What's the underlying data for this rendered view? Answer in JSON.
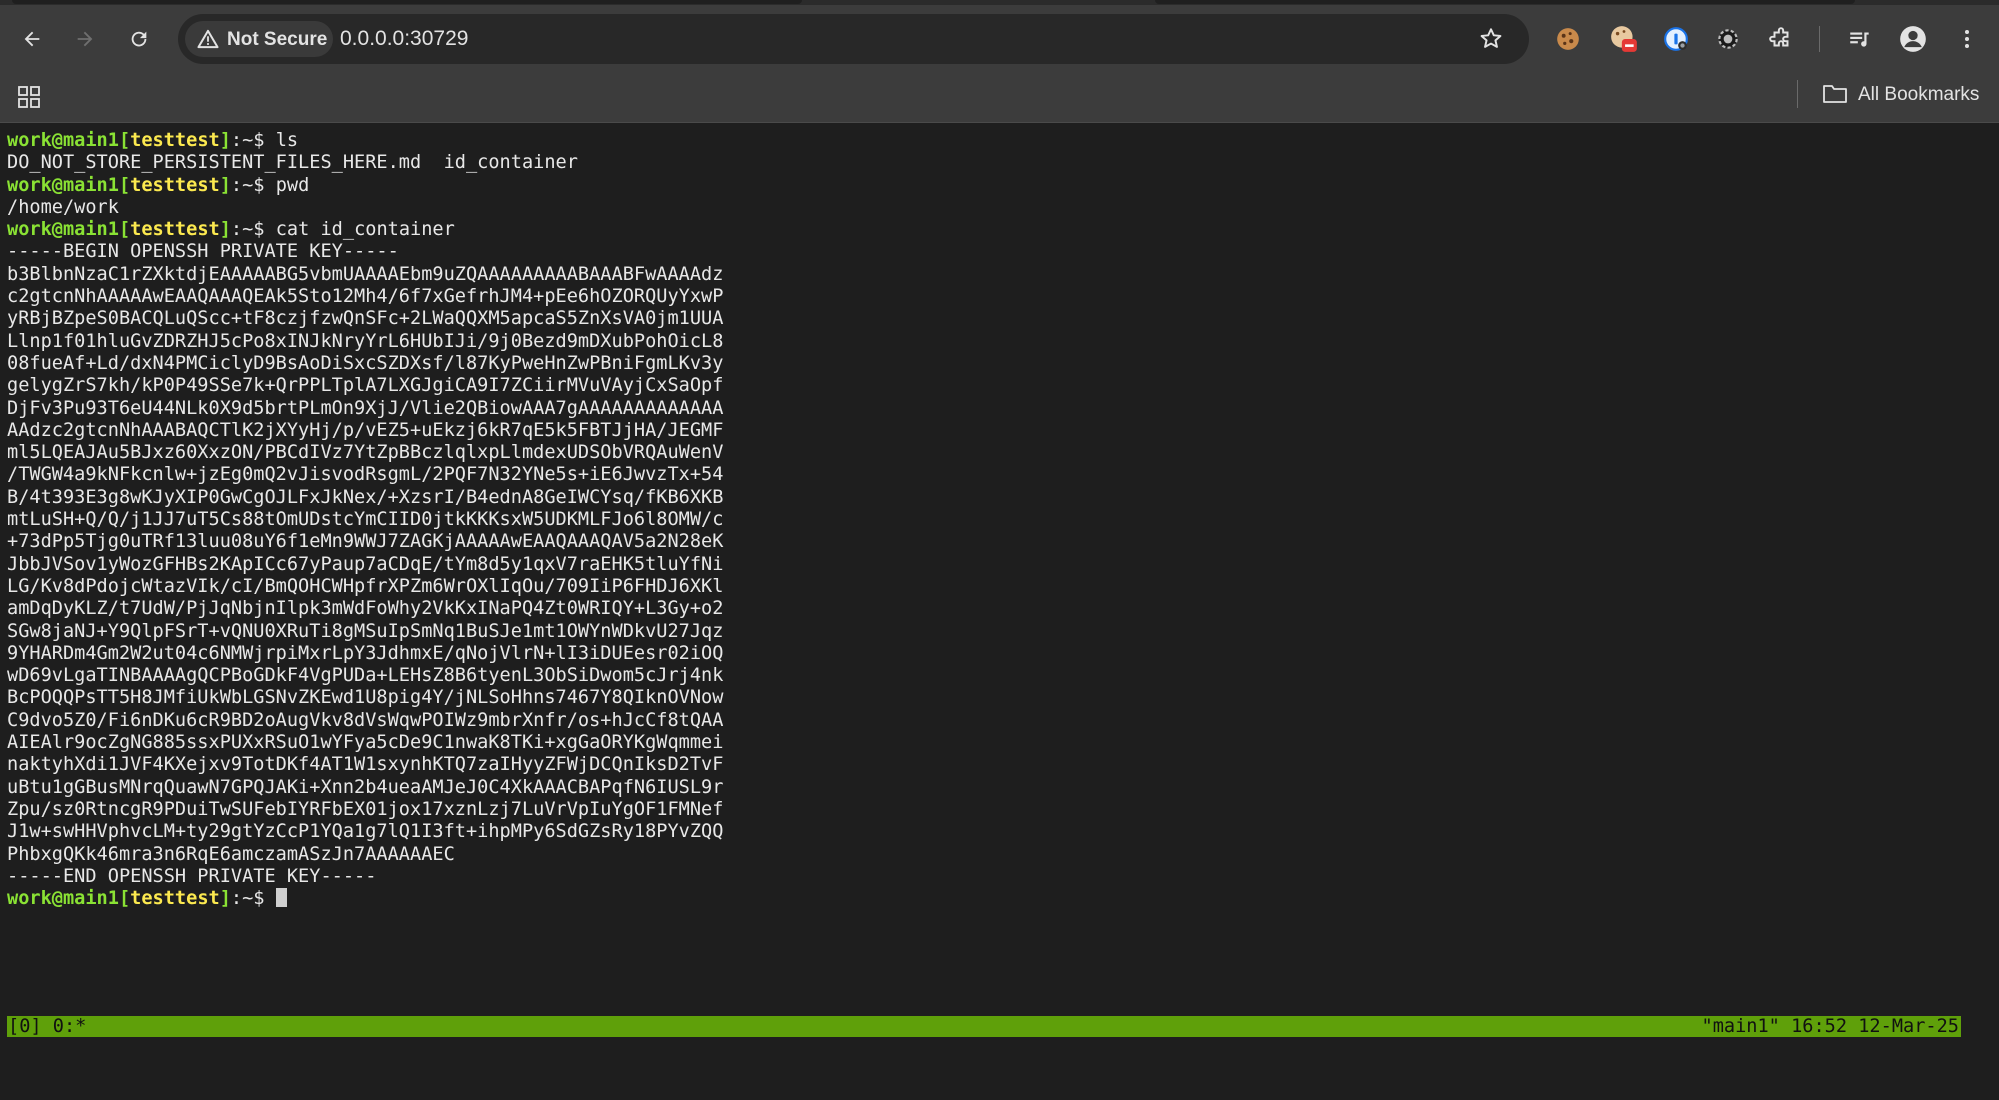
{
  "browser": {
    "security_label": "Not Secure",
    "url": "0.0.0.0:30729",
    "all_bookmarks_label": "All Bookmarks"
  },
  "terminal": {
    "prompt": {
      "user_host": "work@main1",
      "session_open": "[",
      "session": "testtest",
      "session_close": "]",
      "tail": ":~$ "
    },
    "blocks": [
      {
        "command": "ls",
        "output": [
          "DO_NOT_STORE_PERSISTENT_FILES_HERE.md  id_container"
        ]
      },
      {
        "command": "pwd",
        "output": [
          "/home/work"
        ]
      },
      {
        "command": "cat id_container",
        "output": [
          "-----BEGIN OPENSSH PRIVATE KEY-----",
          "b3BlbnNzaC1rZXktdjEAAAAABG5vbmUAAAAEbm9uZQAAAAAAAAABAAABFwAAAAdz",
          "c2gtcnNhAAAAAwEAAQAAAQEAk5Sto12Mh4/6f7xGefrhJM4+pEe6hOZORQUyYxwP",
          "yRBjBZpeS0BACQLuQScc+tF8czjfzwQnSFc+2LWaQQXM5apcaS5ZnXsVA0jm1UUA",
          "Llnp1f01hluGvZDRZHJ5cPo8xINJkNryYrL6HUbIJi/9j0Bezd9mDXubPohOicL8",
          "08fueAf+Ld/dxN4PMCiclyD9BsAoDiSxcSZDXsf/l87KyPweHnZwPBniFgmLKv3y",
          "gelygZrS7kh/kP0P49SSe7k+QrPPLTplA7LXGJgiCA9I7ZCiirMVuVAyjCxSaOpf",
          "DjFv3Pu93T6eU44NLk0X9d5brtPLmOn9XjJ/Vlie2QBiowAAA7gAAAAAAAAAAAAA",
          "AAdzc2gtcnNhAAABAQCTlK2jXYyHj/p/vEZ5+uEkzj6kR7qE5k5FBTJjHA/JEGMF",
          "ml5LQEAJAu5BJxz60XxzON/PBCdIVz7YtZpBBczlqlxpLlmdexUDSObVRQAuWenV",
          "/TWGW4a9kNFkcnlw+jzEg0mQ2vJisvodRsgmL/2PQF7N32YNe5s+iE6JwvzTx+54",
          "B/4t393E3g8wKJyXIP0GwCgOJLFxJkNex/+XzsrI/B4ednA8GeIWCYsq/fKB6XKB",
          "mtLuSH+Q/Q/j1JJ7uT5Cs88tOmUDstcYmCIID0jtkKKKsxW5UDKMLFJo6l8OMW/c",
          "+73dPp5Tjg0uTRf13luu08uY6f1eMn9WWJ7ZAGKjAAAAAwEAAQAAAQAV5a2N28eK",
          "JbbJVSov1yWozGFHBs2KApICc67yPaup7aCDqE/tYm8d5y1qxV7raEHK5tluYfNi",
          "LG/Kv8dPdojcWtazVIk/cI/BmQOHCWHpfrXPZm6WrOXlIqOu/709IiP6FHDJ6XKl",
          "amDqDyKLZ/t7UdW/PjJqNbjnIlpk3mWdFoWhy2VkKxINaPQ4Zt0WRIQY+L3Gy+o2",
          "SGw8jaNJ+Y9QlpFSrT+vQNU0XRuTi8gMSuIpSmNq1BuSJe1mt1OWYnWDkvU27Jqz",
          "9YHARDm4Gm2W2ut04c6NMWjrpiMxrLpY3JdhmxE/qNojVlrN+lI3iDUEesr02iOQ",
          "wD69vLgaTINBAAAAgQCPBoGDkF4VgPUDa+LEHsZ8B6tyenL3ObSiDwom5cJrj4nk",
          "BcPOQQPsTT5H8JMfiUkWbLGSNvZKEwd1U8pig4Y/jNLSoHhns7467Y8QIknOVNow",
          "C9dvo5Z0/Fi6nDKu6cR9BD2oAugVkv8dVsWqwPOIWz9mbrXnfr/os+hJcCf8tQAA",
          "AIEAlr9ocZgNG885ssxPUXxRSuO1wYFya5cDe9C1nwaK8TKi+xgGaORYKgWqmmei",
          "naktyhXdi1JVF4KXejxv9TotDKf4AT1W1sxynhKTQ7zaIHyyZFWjDCQnIksD2TvF",
          "uBtu1gGBusMNrqQuawN7GPQJAKi+Xnn2b4ueaAMJeJ0C4XkAAACBAPqfN6IUSL9r",
          "Zpu/sz0RtncgR9PDuiTwSUFebIYRFbEX01jox17xznLzj7LuVrVpIuYgOF1FMNef",
          "J1w+swHHVphvcLM+ty29gtYzCcP1YQa1g7lQ1I3ft+ihpMPy6SdGZsRy18PYvZQQ",
          "PhbxgQKk46mra3n6RqE6amczamASzJn7AAAAAAEC",
          "-----END OPENSSH PRIVATE KEY-----"
        ]
      }
    ],
    "status_left": "[0] 0:*",
    "status_right": "\"main1\" 16:52 12-Mar-25"
  }
}
